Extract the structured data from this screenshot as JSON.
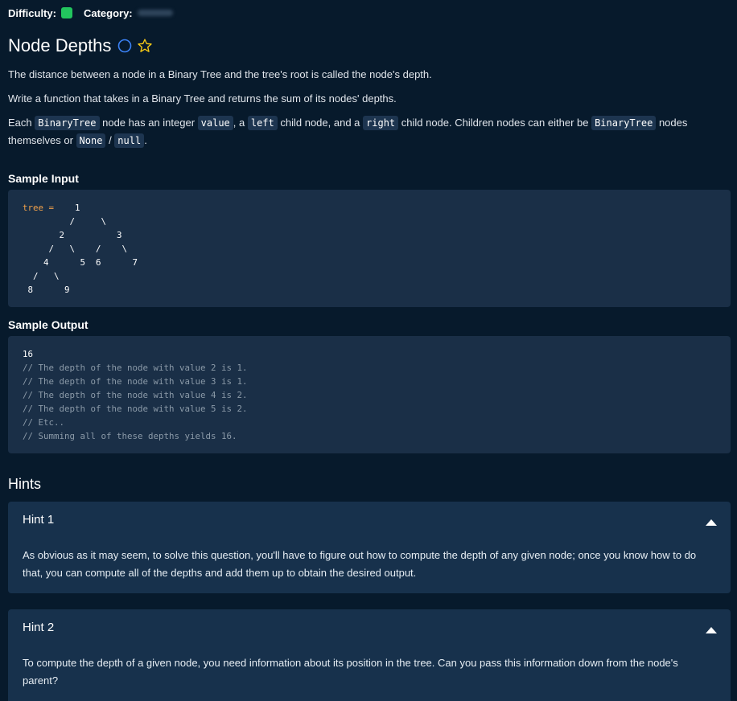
{
  "colors": {
    "difficulty_badge": "#22c55e",
    "background": "#071a2c",
    "code_panel": "#1a2f47",
    "hint_panel": "#17314c",
    "keyword": "#f2a14a",
    "comment": "#8b9aa8"
  },
  "header": {
    "difficulty_label": "Difficulty:",
    "category_label": "Category:"
  },
  "problem": {
    "title": "Node Depths",
    "status_icon": "circle-icon",
    "favorite_icon": "star-icon",
    "para1": "The distance between a node in a Binary Tree and the tree's root is called the node's depth.",
    "para2": "Write a function that takes in a Binary Tree and returns the sum of its nodes' depths.",
    "para3": {
      "t1": "Each ",
      "c1": "BinaryTree",
      "t2": " node has an integer ",
      "c2": "value",
      "t3": ", a ",
      "c3": "left",
      "t4": " child node, and a ",
      "c4": "right",
      "t5": " child node. Children nodes can either be ",
      "c5": "BinaryTree",
      "t6": " nodes themselves or ",
      "c6": "None",
      "t7": " / ",
      "c7": "null",
      "t8": "."
    }
  },
  "sample_input": {
    "title": "Sample Input",
    "keyword": "tree =",
    "code_lines": [
      "    1",
      "         /     \\",
      "       2          3",
      "     /   \\    /    \\",
      "    4      5  6      7",
      "  /   \\",
      " 8      9"
    ]
  },
  "sample_output": {
    "title": "Sample Output",
    "result": "16",
    "comments": [
      "// The depth of the node with value 2 is 1.",
      "// The depth of the node with value 3 is 1.",
      "// The depth of the node with value 4 is 2.",
      "// The depth of the node with value 5 is 2.",
      "// Etc..",
      "// Summing all of these depths yields 16."
    ]
  },
  "hints": {
    "title": "Hints",
    "items": [
      {
        "label": "Hint 1",
        "text": "As obvious as it may seem, to solve this question, you'll have to figure out how to compute the depth of any given node; once you know how to do that, you can compute all of the depths and add them up to obtain the desired output."
      },
      {
        "label": "Hint 2",
        "text": "To compute the depth of a given node, you need information about its position in the tree. Can you pass this information down from the node's parent?"
      }
    ]
  }
}
